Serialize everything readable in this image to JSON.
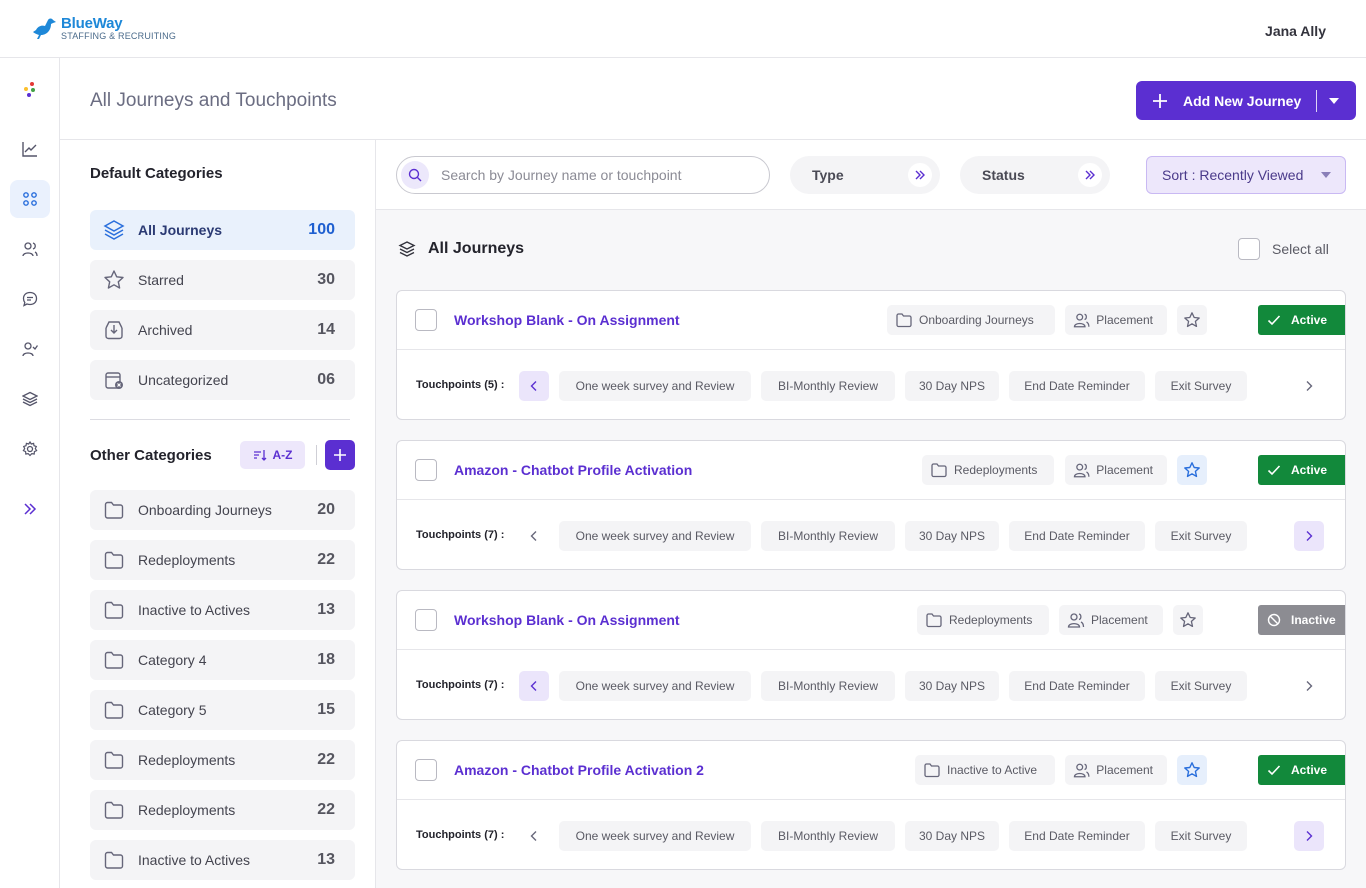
{
  "app": {
    "logo_name": "BlueWay",
    "logo_sub": "STAFFING & RECRUITING",
    "user_name": "Jana Ally"
  },
  "rail": {
    "icons": [
      "app-logo-icon",
      "chart-icon",
      "journeys-icon",
      "users-icon",
      "chat-icon",
      "user-check-icon",
      "layers-icon",
      "settings-icon",
      "expand-icon"
    ],
    "active": "journeys-icon"
  },
  "header": {
    "title": "All Journeys and Touchpoints",
    "add_button": "Add New Journey"
  },
  "default_categories": {
    "heading": "Default Categories",
    "items": [
      {
        "label": "All Journeys",
        "count": "100",
        "icon": "layers-icon",
        "active": true
      },
      {
        "label": "Starred",
        "count": "30",
        "icon": "star-icon"
      },
      {
        "label": "Archived",
        "count": "14",
        "icon": "archive-icon"
      },
      {
        "label": "Uncategorized",
        "count": "06",
        "icon": "uncategorized-icon"
      }
    ]
  },
  "other_categories": {
    "heading": "Other Categories",
    "sort_label": "A-Z",
    "items": [
      {
        "label": "Onboarding Journeys",
        "count": "20"
      },
      {
        "label": "Redeployments",
        "count": "22"
      },
      {
        "label": "Inactive to Actives",
        "count": "13"
      },
      {
        "label": "Category 4",
        "count": "18"
      },
      {
        "label": "Category 5",
        "count": "15"
      },
      {
        "label": "Redeployments",
        "count": "22"
      },
      {
        "label": "Redeployments",
        "count": "22"
      },
      {
        "label": "Inactive to Actives",
        "count": "13"
      }
    ]
  },
  "filters": {
    "search_placeholder": "Search by Journey name or touchpoint",
    "search_value": "",
    "type_label": "Type",
    "status_label": "Status",
    "sort_label": "Sort : Recently Viewed"
  },
  "list": {
    "heading": "All Journeys",
    "select_all": "Select all"
  },
  "journeys": [
    {
      "title": "Workshop Blank - On Assignment",
      "category": "Onboarding Journeys",
      "type": "Placement",
      "starred": false,
      "status": "Active",
      "touchpoints_label": "Touchpoints (5) :",
      "touchpoints": [
        "One week survey and Review",
        "BI-Monthly Review",
        "30 Day NPS",
        "End Date Reminder",
        "Exit Survey"
      ],
      "prev_highlight": true,
      "next_highlight": false
    },
    {
      "title": "Amazon - Chatbot Profile Activation",
      "category": "Redeployments",
      "type": "Placement",
      "starred": true,
      "status": "Active",
      "touchpoints_label": "Touchpoints (7) :",
      "touchpoints": [
        "One week survey and Review",
        "BI-Monthly Review",
        "30 Day NPS",
        "End Date Reminder",
        "Exit Survey"
      ],
      "prev_highlight": false,
      "next_highlight": true
    },
    {
      "title": "Workshop Blank - On Assignment",
      "category": "Redeployments",
      "type": "Placement",
      "starred": false,
      "status": "Inactive",
      "touchpoints_label": "Touchpoints (7) :",
      "touchpoints": [
        "One week survey and Review",
        "BI-Monthly Review",
        "30 Day NPS",
        "End Date Reminder",
        "Exit Survey"
      ],
      "prev_highlight": true,
      "next_highlight": false
    },
    {
      "title": "Amazon - Chatbot Profile Activation 2",
      "category": "Inactive to Active",
      "type": "Placement",
      "starred": true,
      "status": "Active",
      "touchpoints_label": "Touchpoints (7) :",
      "touchpoints": [
        "One week survey and Review",
        "BI-Monthly Review",
        "30 Day NPS",
        "End Date Reminder",
        "Exit Survey"
      ],
      "prev_highlight": false,
      "next_highlight": true
    }
  ],
  "colors": {
    "brand": "#5b2fd1",
    "active_status": "#12893b",
    "inactive_status": "#8c8c92",
    "logo": "#1e88d8"
  }
}
